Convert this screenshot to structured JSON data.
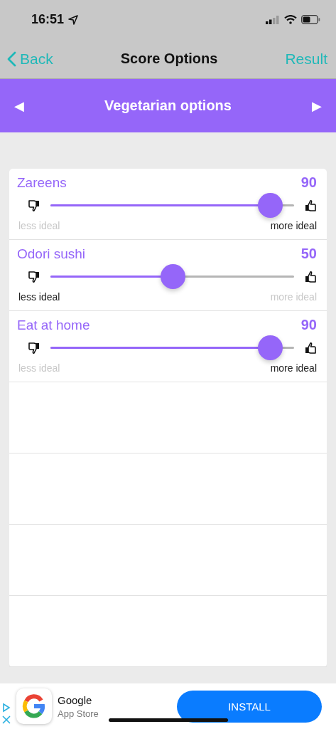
{
  "status_bar": {
    "time": "16:51"
  },
  "nav": {
    "back": "Back",
    "title": "Score Options",
    "action": "Result"
  },
  "category": {
    "prev": "◀",
    "title": "Vegetarian options",
    "next": "▶"
  },
  "options": [
    {
      "name": "Zareens",
      "score": "90",
      "level": 0.9,
      "less": {
        "text": "less ideal",
        "dimmed": true
      },
      "more": {
        "text": "more ideal",
        "dimmed": false
      }
    },
    {
      "name": "Odori sushi",
      "score": "50",
      "level": 0.5,
      "less": {
        "text": "less ideal",
        "dimmed": false
      },
      "more": {
        "text": "more ideal",
        "dimmed": true
      }
    },
    {
      "name": "Eat at home",
      "score": "90",
      "level": 0.9,
      "less": {
        "text": "less ideal",
        "dimmed": true
      },
      "more": {
        "text": "more ideal",
        "dimmed": false
      }
    }
  ],
  "ad": {
    "title": "Google",
    "subtitle": "App Store",
    "button": "INSTALL"
  }
}
